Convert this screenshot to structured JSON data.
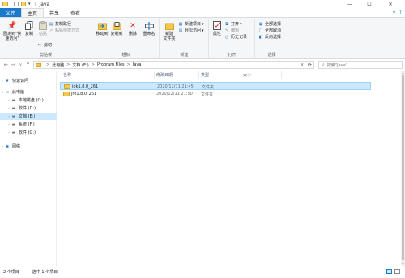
{
  "window": {
    "title": "Java"
  },
  "controls": {
    "minimize": "—",
    "maximize": "☐",
    "close": "✕"
  },
  "tabs": [
    {
      "label": "文件"
    },
    {
      "label": "主页"
    },
    {
      "label": "共享"
    },
    {
      "label": "查看"
    }
  ],
  "tabs_right": {
    "collapse": "∨",
    "help": "?"
  },
  "ribbon": {
    "clipboard": {
      "pin_label": "固定到\"快\n速访问\"",
      "copy_label": "复制",
      "paste_label": "粘贴",
      "cut_label": "剪切",
      "copy_path_label": "复制路径",
      "paste_shortcut_label": "粘贴快捷方式",
      "group_label": "剪贴板"
    },
    "organize": {
      "move_to_label": "移动到",
      "copy_to_label": "复制到",
      "delete_label": "删除",
      "rename_label": "重命名",
      "group_label": "组织"
    },
    "new": {
      "new_folder_label": "新建\n文件夹",
      "new_item_label": "新建项目",
      "easy_access_label": "轻松访问",
      "group_label": "新建"
    },
    "open": {
      "properties_label": "属性",
      "open_label": "打开",
      "edit_label": "编辑",
      "history_label": "历史记录",
      "group_label": "打开"
    },
    "select": {
      "select_all_label": "全部选择",
      "select_none_label": "全部取消",
      "invert_label": "反向选择",
      "group_label": "选择"
    }
  },
  "addressbar": {
    "back": "←",
    "forward": "→",
    "recent": "∨",
    "up": "↑",
    "crumbs": [
      "此电脑",
      "文档 (E:)",
      "Program Files",
      "Java"
    ],
    "separator": ">",
    "dropdown": "∨",
    "refresh": "⟳",
    "search_placeholder": "搜索\"Java\""
  },
  "nav": {
    "quick_access": "快速访问",
    "this_pc": "此电脑",
    "drives": [
      {
        "label": "本地磁盘 (C:)"
      },
      {
        "label": "软件 (D:)"
      },
      {
        "label": "文档 (E:)"
      },
      {
        "label": "系统 (F:)"
      },
      {
        "label": "软件 (G:)"
      }
    ],
    "network": "网络"
  },
  "filelist": {
    "columns": [
      "名称",
      "修改日期",
      "类型",
      "大小"
    ],
    "rows": [
      {
        "name": "jdk1.8.0_261",
        "modified": "2020/12/11 21:45",
        "type": "文件夹",
        "size": ""
      },
      {
        "name": "jre1.8.0_261",
        "modified": "2020/12/11 21:50",
        "type": "文件夹",
        "size": ""
      }
    ]
  },
  "status": {
    "item_count": "2 个项目",
    "selected": "选中 1 个项目"
  }
}
